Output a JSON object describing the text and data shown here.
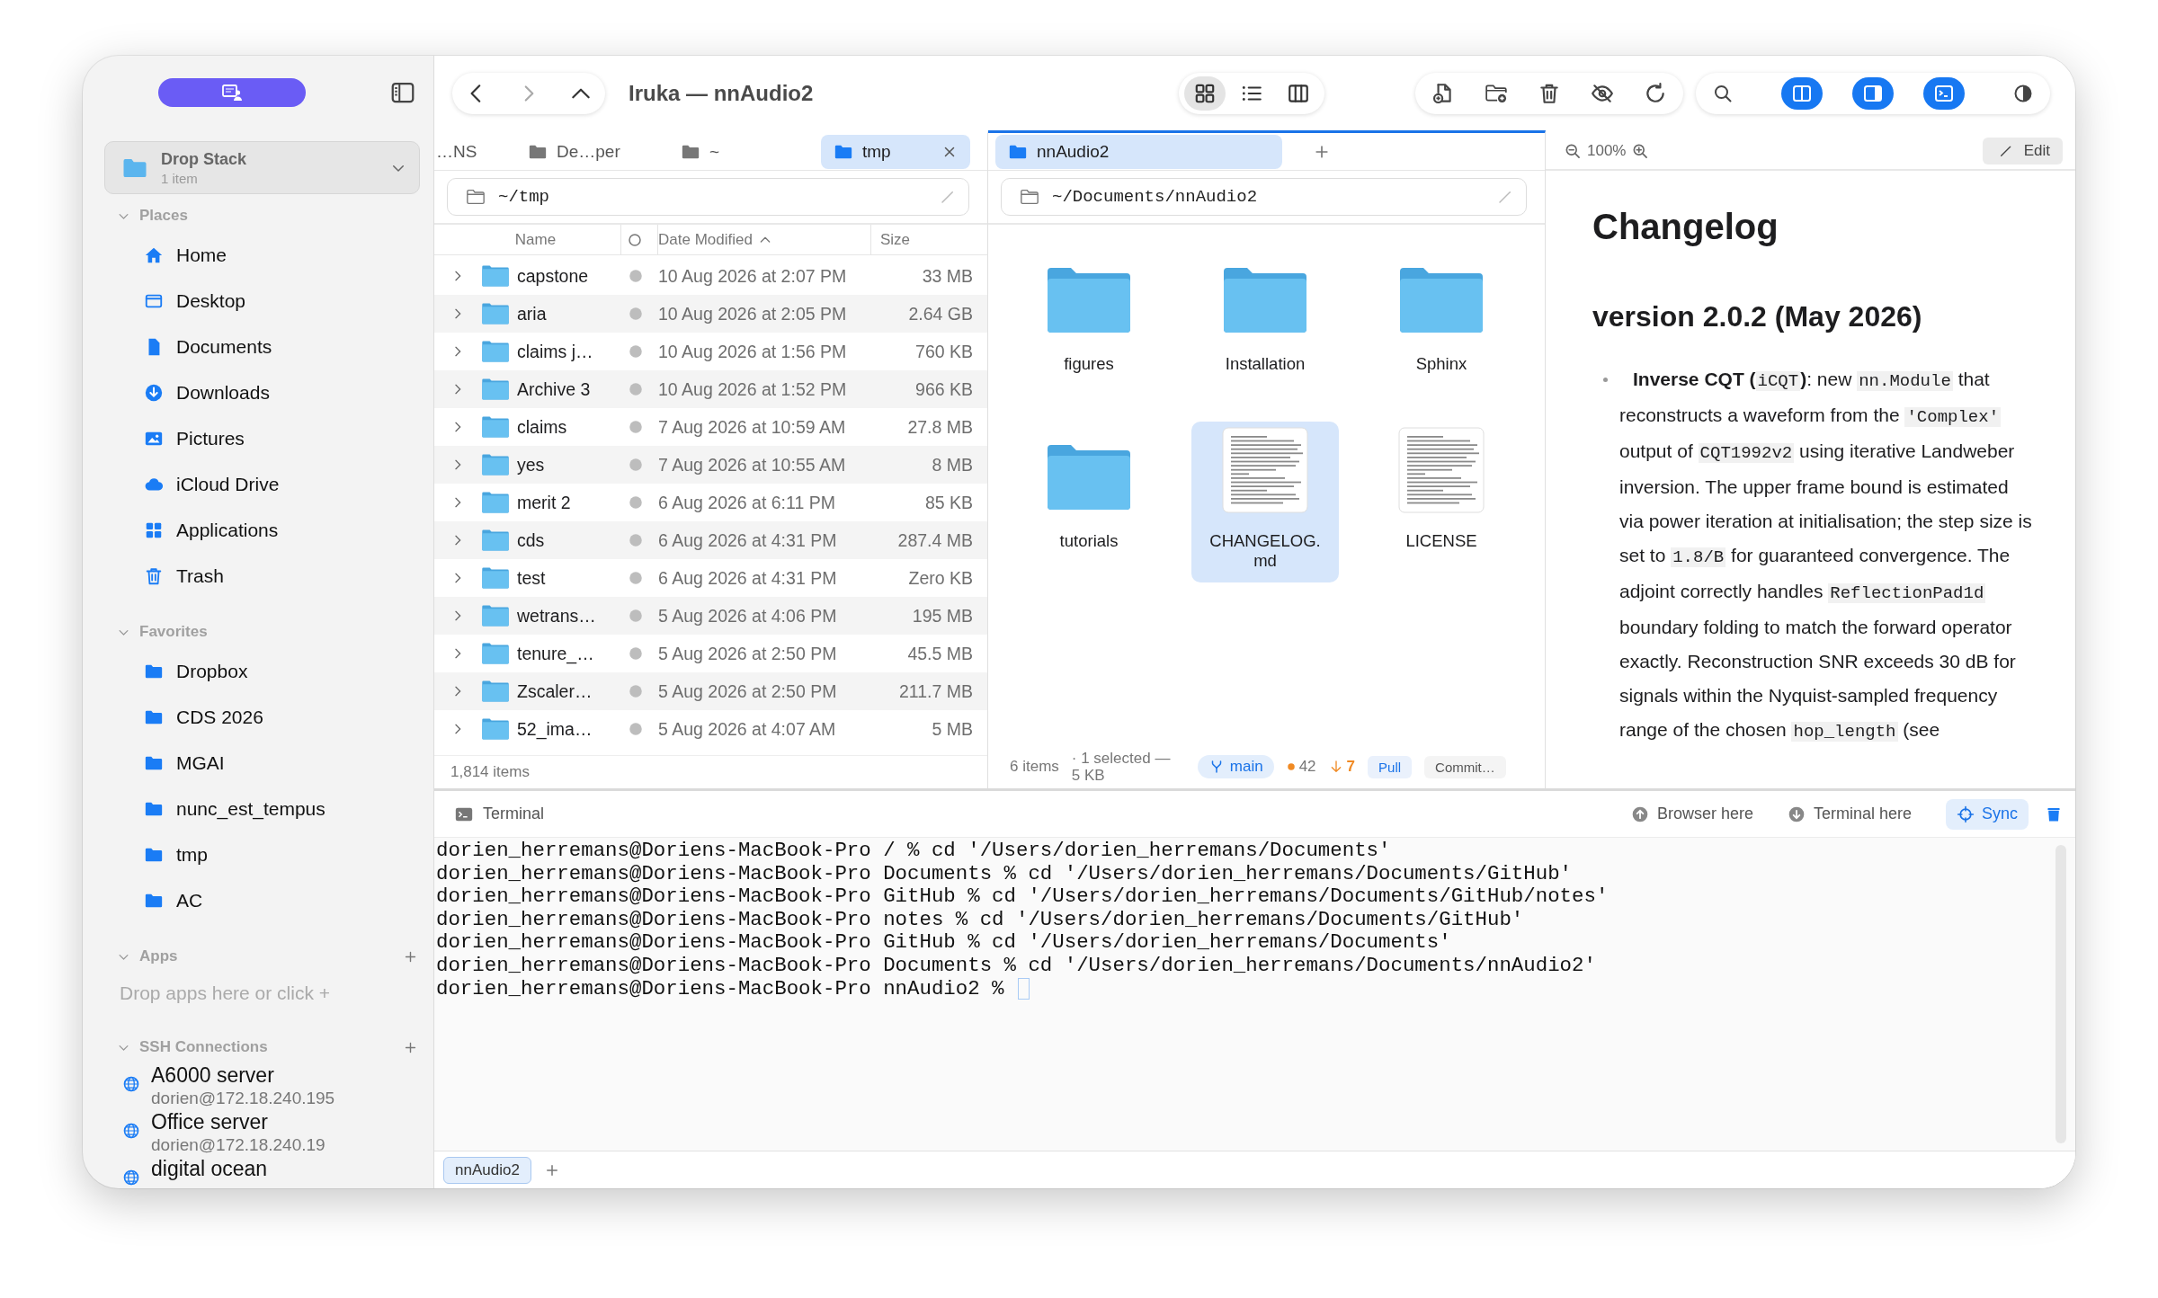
{
  "sidebar": {
    "drop_stack": {
      "title": "Drop Stack",
      "count": "1 item"
    },
    "sections": [
      {
        "title": "Places",
        "kind": "places",
        "expanded": true,
        "items": [
          "Home",
          "Desktop",
          "Documents",
          "Downloads",
          "Pictures",
          "iCloud Drive",
          "Applications",
          "Trash"
        ]
      },
      {
        "title": "Favorites",
        "kind": "folders",
        "expanded": true,
        "items": [
          "Dropbox",
          "CDS 2026",
          "MGAI",
          "nunc_est_tempus",
          "tmp",
          "AC"
        ]
      },
      {
        "title": "Apps",
        "kind": "apps",
        "expanded": true,
        "hint": "Drop apps here or click +"
      },
      {
        "title": "SSH Connections",
        "kind": "ssh",
        "expanded": true,
        "connections": [
          {
            "name": "A6000 server",
            "address": "dorien@172.18.240.195"
          },
          {
            "name": "Office server",
            "address": "dorien@172.18.240.19"
          },
          {
            "name": "digital ocean"
          }
        ]
      }
    ]
  },
  "toolbar": {
    "title": "Iruka — nnAudio2",
    "views": [
      {
        "selected": true
      },
      {
        "selected": false
      },
      {
        "selected": false
      }
    ],
    "panel_toggles": [
      {
        "selected": true
      },
      {
        "selected": true
      },
      {
        "selected": true
      }
    ]
  },
  "left_pane": {
    "active": false,
    "tabs": [
      {
        "label": "…NS",
        "selected": false,
        "truncated": true
      },
      {
        "label": "De…per",
        "selected": false,
        "truncated": false
      },
      {
        "label": "~",
        "selected": false,
        "truncated": false
      },
      {
        "label": "tmp",
        "selected": true,
        "truncated": false
      }
    ],
    "path": "~/tmp",
    "columns": [
      {
        "label": "Name",
        "sorted": false
      },
      {
        "label": "Date Modified",
        "sorted": true
      },
      {
        "label": "Size",
        "sorted": false
      }
    ],
    "rows": [
      {
        "name": "capstone",
        "modified": "10 Aug 2026 at 2:07 PM",
        "size": "33 MB",
        "expanded": false
      },
      {
        "name": "aria",
        "modified": "10 Aug 2026 at 2:05 PM",
        "size": "2.64 GB",
        "expanded": false
      },
      {
        "name": "claims j…",
        "modified": "10 Aug 2026 at 1:56 PM",
        "size": "760 KB",
        "expanded": false
      },
      {
        "name": "Archive 3",
        "modified": "10 Aug 2026 at 1:52 PM",
        "size": "966 KB",
        "expanded": false
      },
      {
        "name": "claims",
        "modified": "7 Aug 2026 at 10:59 AM",
        "size": "27.8 MB",
        "expanded": false
      },
      {
        "name": "yes",
        "modified": "7 Aug 2026 at 10:55 AM",
        "size": "8 MB",
        "expanded": false
      },
      {
        "name": "merit 2",
        "modified": "6 Aug 2026 at 6:11 PM",
        "size": "85 KB",
        "expanded": false
      },
      {
        "name": "cds",
        "modified": "6 Aug 2026 at 4:31 PM",
        "size": "287.4 MB",
        "expanded": false
      },
      {
        "name": "test",
        "modified": "6 Aug 2026 at 4:31 PM",
        "size": "Zero KB",
        "expanded": false
      },
      {
        "name": "wetrans…",
        "modified": "5 Aug 2026 at 4:06 PM",
        "size": "195 MB",
        "expanded": false
      },
      {
        "name": "tenure_…",
        "modified": "5 Aug 2026 at 2:50 PM",
        "size": "45.5 MB",
        "expanded": false
      },
      {
        "name": "Zscaler…",
        "modified": "5 Aug 2026 at 2:50 PM",
        "size": "211.7 MB",
        "expanded": false
      },
      {
        "name": "52_ima…",
        "modified": "5 Aug 2026 at 4:07 AM",
        "size": "5 MB",
        "expanded": false
      }
    ],
    "status": "1,814 items"
  },
  "middle_pane": {
    "active": true,
    "tabs": [
      {
        "label": "nnAudio2",
        "selected": true
      }
    ],
    "path": "~/Documents/nnAudio2",
    "items": [
      {
        "name": "figures",
        "kind": "folder",
        "selected": false
      },
      {
        "name": "Installation",
        "kind": "folder",
        "selected": false
      },
      {
        "name": "Sphinx",
        "kind": "folder",
        "selected": false
      },
      {
        "name": "tutorials",
        "kind": "folder",
        "selected": false
      },
      {
        "name": "CHANGELOG.md",
        "kind": "document",
        "selected": true
      },
      {
        "name": "LICENSE",
        "kind": "document",
        "selected": false
      }
    ],
    "status": {
      "count": "6 items",
      "selection": "· 1 selected — 5 KB",
      "branch": "main",
      "changes": "42",
      "behind": "7",
      "pull": "Pull",
      "commit": "Commit…"
    }
  },
  "preview_pane": {
    "active": false,
    "zoom": "100%",
    "edit_button": "Edit",
    "title": "Changelog",
    "version_heading": "version 2.0.2 (May 2026)",
    "bullets": [
      {
        "segments": [
          {
            "kind": "bold",
            "text": "Inverse CQT ("
          },
          {
            "kind": "code",
            "text": "iCQT"
          },
          {
            "kind": "bold",
            "text": ")"
          },
          {
            "kind": "plain",
            "text": ": new "
          },
          {
            "kind": "code",
            "text": "nn.Module"
          },
          {
            "kind": "plain",
            "text": " that reconstructs a waveform from the "
          },
          {
            "kind": "code",
            "text": "'Complex'"
          },
          {
            "kind": "plain",
            "text": " output of "
          },
          {
            "kind": "code",
            "text": "CQT1992v2"
          },
          {
            "kind": "plain",
            "text": " using iterative Landweber inversion. The upper frame bound is estimated via power iteration at initialisation; the step size is set to "
          },
          {
            "kind": "code",
            "text": "1.8/B"
          },
          {
            "kind": "plain",
            "text": " for guaranteed convergence. The adjoint correctly handles "
          },
          {
            "kind": "code",
            "text": "ReflectionPad1d"
          },
          {
            "kind": "plain",
            "text": " boundary folding to match the forward operator exactly. Reconstruction SNR exceeds 30 dB for signals within the Nyquist-sampled frequency range of the chosen "
          },
          {
            "kind": "code",
            "text": "hop_length"
          },
          {
            "kind": "plain",
            "text": " (see"
          }
        ]
      }
    ]
  },
  "terminal": {
    "title": "Terminal",
    "actions": [
      {
        "label": "Browser here",
        "kind": "up"
      },
      {
        "label": "Terminal here",
        "kind": "down"
      }
    ],
    "sync": {
      "label": "Sync",
      "selected": true
    },
    "lines": [
      "dorien_herremans@Doriens-MacBook-Pro / % cd '/Users/dorien_herremans/Documents'",
      "dorien_herremans@Doriens-MacBook-Pro Documents % cd '/Users/dorien_herremans/Documents/GitHub'",
      "dorien_herremans@Doriens-MacBook-Pro GitHub % cd '/Users/dorien_herremans/Documents/GitHub/notes'",
      "dorien_herremans@Doriens-MacBook-Pro notes % cd '/Users/dorien_herremans/Documents/GitHub'",
      "dorien_herremans@Doriens-MacBook-Pro GitHub % cd '/Users/dorien_herremans/Documents'",
      "dorien_herremans@Doriens-MacBook-Pro Documents % cd '/Users/dorien_herremans/Documents/nnAudio2'",
      "dorien_herremans@Doriens-MacBook-Pro nnAudio2 % "
    ],
    "tabs": [
      {
        "label": "nnAudio2",
        "selected": true
      }
    ]
  }
}
